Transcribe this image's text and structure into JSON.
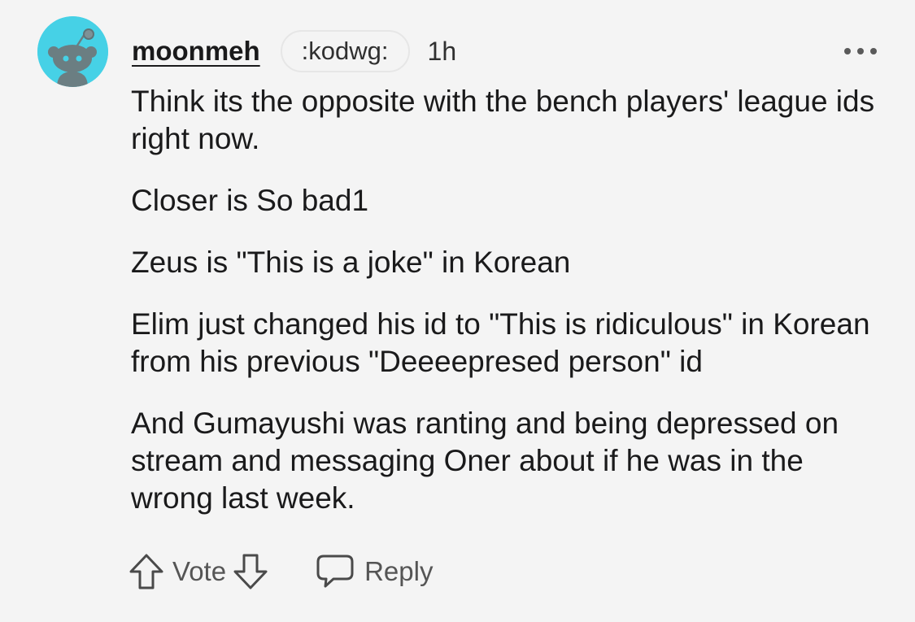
{
  "comment": {
    "author": "moonmeh",
    "flair": ":kodwg:",
    "time": "1h",
    "avatar_icon": "snoo-avatar-icon",
    "avatar_color": "#46d1e6",
    "paragraphs": [
      "Think its the opposite with the bench players' league ids right now.",
      "Closer is So bad1",
      "Zeus is \"This is a joke\" in Korean",
      "Elim just changed his id to \"This is ridiculous\" in Korean from his previous \"Deeeepresed person\" id",
      "And Gumayushi was ranting and being depressed on stream and messaging Oner about if he was in the wrong last week."
    ]
  },
  "actions": {
    "upvote_icon": "arrow-up-icon",
    "vote_label": "Vote",
    "downvote_icon": "arrow-down-icon",
    "reply_icon": "speech-bubble-icon",
    "reply_label": "Reply"
  },
  "menu": {
    "icon": "more-horizontal-icon"
  }
}
